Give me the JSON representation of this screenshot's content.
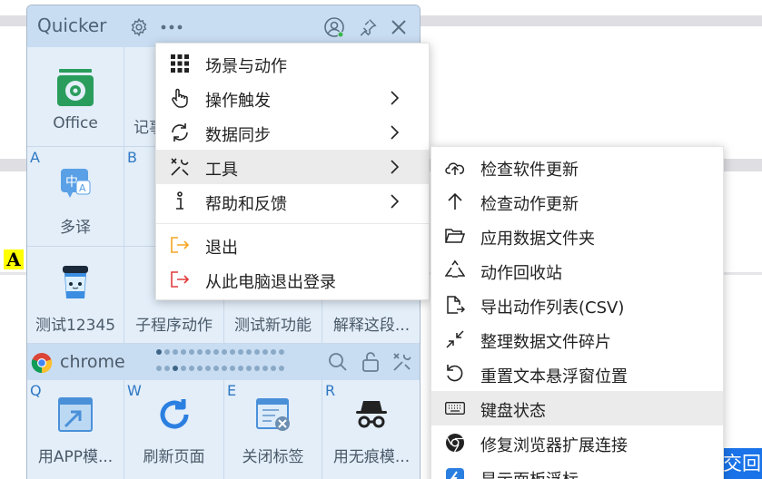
{
  "panel": {
    "title": "Quicker",
    "grid": [
      {
        "label": "Office",
        "hotkey": "",
        "icon": "office-icon"
      },
      {
        "label": "记事",
        "hotkey": "",
        "icon": "notepad-icon"
      },
      {
        "label": "多译",
        "hotkey": "A",
        "icon": "translate-icon"
      },
      {
        "label": "",
        "hotkey": "B",
        "icon": ""
      },
      {
        "label": "测试12345",
        "hotkey": "",
        "icon": "cup-icon"
      },
      {
        "label": "子程序动作",
        "hotkey": "",
        "icon": ""
      },
      {
        "label": "测试新功能",
        "hotkey": "",
        "icon": ""
      },
      {
        "label": "解释这段...",
        "hotkey": "",
        "icon": ""
      }
    ],
    "context_label": "chrome",
    "bottom": [
      {
        "label": "用APP模...",
        "hotkey": "Q",
        "icon": "app-mode-icon"
      },
      {
        "label": "刷新页面",
        "hotkey": "W",
        "icon": "refresh-icon"
      },
      {
        "label": "关闭标签",
        "hotkey": "E",
        "icon": "close-tab-icon"
      },
      {
        "label": "用无痕模...",
        "hotkey": "R",
        "icon": "incognito-icon"
      }
    ]
  },
  "main_menu": {
    "items": [
      {
        "label": "场景与动作",
        "icon": "grid-icon",
        "submenu": false
      },
      {
        "label": "操作触发",
        "icon": "hand-pointer-icon",
        "submenu": true
      },
      {
        "label": "数据同步",
        "icon": "sync-icon",
        "submenu": true
      },
      {
        "label": "工具",
        "icon": "tools-icon",
        "submenu": true,
        "selected": true
      },
      {
        "label": "帮助和反馈",
        "icon": "info-icon",
        "submenu": true
      },
      {
        "label": "退出",
        "icon": "exit-icon",
        "submenu": false
      },
      {
        "label": "从此电脑退出登录",
        "icon": "logout-icon",
        "submenu": false
      }
    ]
  },
  "tools_menu": {
    "items": [
      {
        "label": "检查软件更新",
        "icon": "cloud-upload-icon"
      },
      {
        "label": "检查动作更新",
        "icon": "arrow-up-icon"
      },
      {
        "label": "应用数据文件夹",
        "icon": "folder-open-icon"
      },
      {
        "label": "动作回收站",
        "icon": "recycle-icon"
      },
      {
        "label": "导出动作列表(CSV)",
        "icon": "export-file-icon"
      },
      {
        "label": "整理数据文件碎片",
        "icon": "compress-icon"
      },
      {
        "label": "重置文本悬浮窗位置",
        "icon": "reset-icon"
      },
      {
        "label": "键盘状态",
        "icon": "keyboard-icon",
        "selected": true
      },
      {
        "label": "修复浏览器扩展连接",
        "icon": "chrome-icon"
      },
      {
        "label": "显示面板浮标",
        "icon": "panel-float-icon"
      }
    ]
  },
  "background": {
    "badge": "A",
    "button_text": "交回"
  },
  "colors": {
    "accent": "#2f78c4",
    "exit_orange": "#f5a623",
    "logout_red": "#e03c3c"
  }
}
